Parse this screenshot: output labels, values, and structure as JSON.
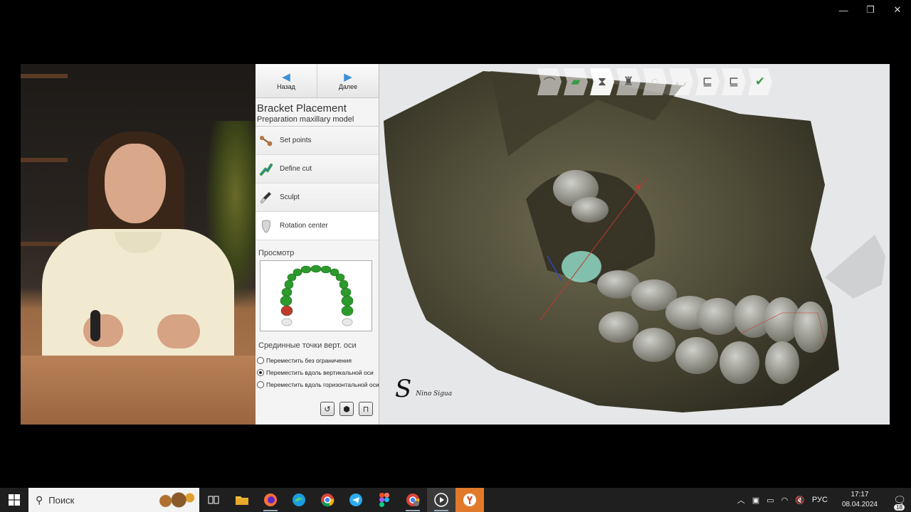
{
  "window_controls": {
    "minimize": "—",
    "maximize": "❐",
    "close": "✕"
  },
  "software": {
    "nav": {
      "back_label": "Назад",
      "next_label": "Далее"
    },
    "title": "Bracket Placement",
    "subtitle": "Preparation maxillary model",
    "steps": [
      {
        "label": "Set points",
        "icon": "set-points-icon"
      },
      {
        "label": "Define cut",
        "icon": "define-cut-icon"
      },
      {
        "label": "Sculpt",
        "icon": "sculpt-icon"
      },
      {
        "label": "Rotation center",
        "icon": "rotation-center-icon",
        "active": true
      }
    ],
    "preview_title": "Просмотр",
    "midpoints_title": "Срединные точки верт. оси",
    "options": [
      {
        "label": "Переместить без ограничения",
        "selected": false
      },
      {
        "label": "Переместить вдоль вертикальной оси",
        "selected": true
      },
      {
        "label": "Переместить вдоль горизонтальной оси",
        "selected": false
      }
    ],
    "tool_buttons": [
      "reset-view-icon",
      "tooth-view-icon",
      "lock-icon"
    ]
  },
  "viewport": {
    "toolbar": [
      "scan-icon",
      "model-base-icon",
      "bracket-icon",
      "tooth-axis-icon",
      "empty-step-icon",
      "empty-step-icon",
      "bracket-set-icon",
      "bracket-set-2-icon",
      "export-check-icon"
    ],
    "active_step": 2
  },
  "logo": {
    "mark": "S",
    "text": "Nino Sigua"
  },
  "taskbar": {
    "search_placeholder": "Поиск",
    "apps": [
      "task-view-icon",
      "file-explorer-icon",
      "firefox-icon",
      "edge-icon",
      "chrome-icon",
      "telegram-icon",
      "figma-icon",
      "chrome-profile-icon",
      "media-player-icon",
      "yandex-browser-icon"
    ],
    "tray": {
      "language": "РУС",
      "time": "17:17",
      "date": "08.04.2024",
      "notifications": "18"
    }
  },
  "colors": {
    "accent": "#3c8fd6",
    "taskbar": "#1f1f1f",
    "yandex": "#e07a2a"
  }
}
